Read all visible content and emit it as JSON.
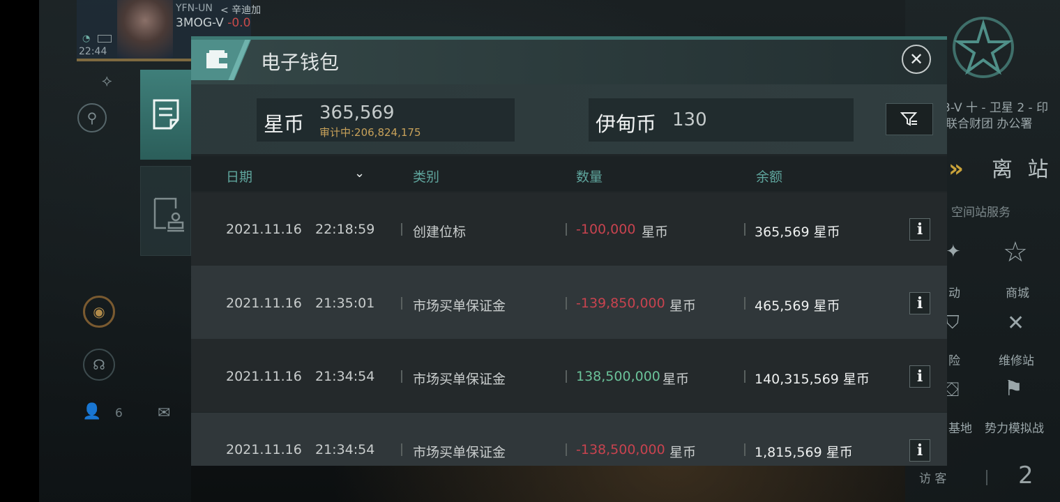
{
  "hud": {
    "system_code": "YFN-UN",
    "location_name": "< 辛迪加",
    "ship_name": "3MOG-V",
    "security_status": "-0.0",
    "clock": "22:44",
    "contacts_count": "6"
  },
  "wallet": {
    "title": "电子钱包",
    "star_coin_label": "星币",
    "star_coin_amount": "365,569",
    "audit_text": "审计中:206,824,175",
    "eden_coin_label": "伊甸币",
    "eden_coin_amount": "130"
  },
  "table": {
    "headers": {
      "date": "日期",
      "category": "类别",
      "amount": "数量",
      "balance": "余额"
    },
    "unit": "星币",
    "rows": [
      {
        "date": "2021.11.16",
        "time": "22:18:59",
        "category": "创建位标",
        "amount": "-100,000",
        "balance": "365,569 星币"
      },
      {
        "date": "2021.11.16",
        "time": "21:35:01",
        "category": "市场买单保证金",
        "amount": "-139,850,000",
        "balance": "465,569 星币"
      },
      {
        "date": "2021.11.16",
        "time": "21:34:54",
        "category": "市场买单保证金",
        "amount": "138,500,000",
        "balance": "140,315,569 星币"
      },
      {
        "date": "2021.11.16",
        "time": "21:34:54",
        "category": "市场买单保证金",
        "amount": "-138,500,000",
        "balance": "1,815,569 星币"
      }
    ]
  },
  "station": {
    "location_line1": "3-V 十 - 卫星 2 - 印",
    "location_line2": "联合财团 办公署",
    "undock_label": "离 站",
    "services_title": "空间站服务",
    "services": {
      "activity": "动",
      "shop": "商城",
      "insurance": "险",
      "repair": "维修站",
      "base": "基地",
      "faction": "势力模拟战"
    },
    "shop_icon_text": "商城",
    "visitors_label": "访 客",
    "visitors_count": "2"
  },
  "colors": {
    "accent_teal": "#3d7873",
    "negative": "#c8434f",
    "positive": "#6bc39a",
    "audit_gold": "#c8a25a"
  }
}
